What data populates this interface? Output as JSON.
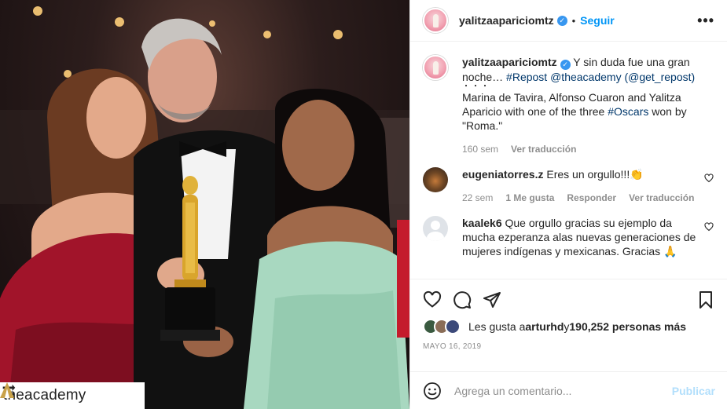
{
  "photo": {
    "alt": "",
    "repost_account": "theacademy"
  },
  "header": {
    "username": "yalitzaapariciomtz",
    "separator": "•",
    "follow_label": "Seguir",
    "more_label": "•••"
  },
  "caption": {
    "username": "yalitzaapariciomtz",
    "text_start": "Y sin duda fue una gran noche… ",
    "hashtag_repost": "#Repost",
    "mention_academy": "@theacademy",
    "get_repost": "(@get_repost)",
    "dots": "・・・",
    "body": "Marina de Tavira, Alfonso Cuaron and Yalitza Aparicio with one of the three ",
    "hashtag_oscars": "#Oscars",
    "body_end": " won by \"Roma.\"",
    "time": "160 sem",
    "translate": "Ver traducción"
  },
  "comments": [
    {
      "username": "eugeniatorres.z",
      "text": "Eres un orgullo!!!👏",
      "time": "22 sem",
      "likes": "1 Me gusta",
      "reply": "Responder",
      "translate": "Ver traducción"
    },
    {
      "username": "kaalek6",
      "text": "Que orgullo gracias su ejemplo da mucha ezperanza alas nuevas generaciones de mujeres indígenas y mexicanas. Gracias 🙏"
    }
  ],
  "likes": {
    "prefix": "Les gusta a ",
    "user": "arturhd",
    "middle": " y ",
    "count": "190,252 personas más"
  },
  "date": "MAYO 16, 2019",
  "add_comment": {
    "placeholder": "Agrega un comentario...",
    "publish_label": "Publicar"
  },
  "colors": {
    "accent": "#0095f6",
    "link": "#00376b",
    "muted": "#8e8e8e",
    "publish_disabled": "#b2dffc"
  }
}
